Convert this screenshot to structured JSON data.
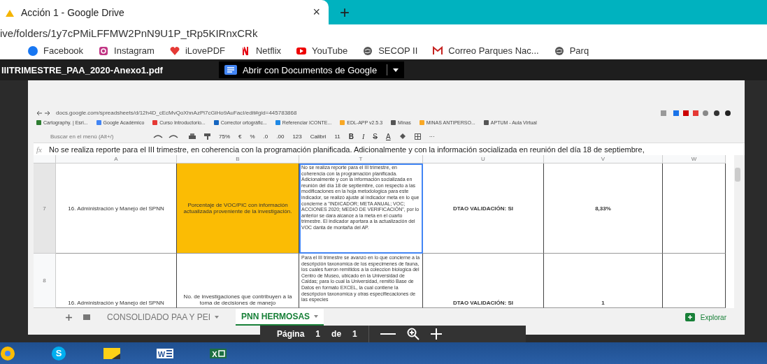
{
  "browser": {
    "tab": {
      "title": "Acción 1 - Google Drive",
      "close": "×",
      "new_tab": "+"
    },
    "url": "ive/folders/1y7cPMiLFFMW2PnN9U1P_tRp5KIRnxCRk",
    "bookmarks": [
      {
        "label": "Facebook",
        "kind": "facebook"
      },
      {
        "label": "Instagram",
        "kind": "instagram"
      },
      {
        "label": "iLovePDF",
        "kind": "heart"
      },
      {
        "label": "Netflix",
        "kind": "netflix"
      },
      {
        "label": "YouTube",
        "kind": "youtube"
      },
      {
        "label": "SECOP II",
        "kind": "globe"
      },
      {
        "label": "Correo Parques Nac...",
        "kind": "mail"
      },
      {
        "label": "Parq",
        "kind": "globe"
      }
    ]
  },
  "pdf_viewer": {
    "filename": "IIITRIMESTRE_PAA_2020-Anexo1.pdf",
    "open_with": "Abrir con Documentos de Google"
  },
  "document": {
    "url": "docs.google.com/spreadsheets/d/12h4D_cEcMvQoXhnAzPi7cGiHo9AuFacI/edit#gid=445783868",
    "bookmarks": [
      {
        "label": "Cartography. | Esri...",
        "color": "#2e7d32"
      },
      {
        "label": "Google Académico",
        "color": "#4285f4"
      },
      {
        "label": "Curso Introductorio...",
        "color": "#e53935"
      },
      {
        "label": "Corrector ortográfic...",
        "color": "#1565c0"
      },
      {
        "label": "Referenciar ICONTE...",
        "color": "#1e88e5"
      },
      {
        "label": "EDL-APP v2.5.3",
        "color": "#f9a825"
      },
      {
        "label": "Minas",
        "color": "#555555"
      },
      {
        "label": "MINAS ANTIPERSO...",
        "color": "#f9a825"
      },
      {
        "label": "APTUM - Aula Virtual",
        "color": "#555555"
      }
    ],
    "toolbar": {
      "search_placeholder": "Buscar en el menú (Alt+/)",
      "zoom": "75%",
      "currency": "€",
      "percent": "%",
      "decimal_less": ".0",
      "decimal_more": ".00",
      "number_format": "123",
      "font": "Calibri",
      "font_size": "11",
      "bold": "B",
      "italic": "I",
      "strike": "S",
      "text_color": "A",
      "more": "···"
    },
    "formula_bar": {
      "label": "fx",
      "value": "No se realiza reporte para el III trimestre, en coherencia con la programación planificada. Adicionalmente y con la información socializada en reunión del día 18 de septiembre,"
    },
    "table": {
      "columns": [
        "A",
        "B",
        "T",
        "U",
        "V",
        "W"
      ],
      "rows": [
        {
          "number": "7",
          "cells": [
            "16. Administración y Manejo del SPNN",
            "Porcentaje de VOC/PIC con información actualizada proveniente de la investigación.",
            "No se realiza reporte para el III trimestre, en coherencia con la programación planificada. Adicionalmente y con la información socializada en reunión del día 18 de septiembre, con respecto a las modificaciones en la hoja metodologica para este indicador, se realizó ajuste al indicador meta en lo que concierne a \"INDICADOR; META ANUAL; VOC; ACCIONES 2020; MEDIO DE VERIFICACIÓN\", por lo anterior se dara alcance a la meta en el cuarto trimestre. El indicador aportara a la actualización del VOC danta de montaña del AP.",
            "DTAO VALIDACIÓN: SI",
            "8,33%"
          ],
          "highlighted": true,
          "selected": true
        },
        {
          "number": "8",
          "cells": [
            "16. Administración y Manejo del SPNN",
            "No. de investigaciones que contribuyen a la toma de decisiones de manejo",
            "Para el III trimestre se avanzó en lo que concierne a la descripción taxonomica de los especimenes de fauna, los cuales fueron remitidos a la coleccion biologica del Centro de Museo, ubicado en la Universidad de Caldas; para lo cual la Universidad,    remitió Base de Datos en formato EXCEL, la cual contiene la descripcion taxonomica y otras especifiecaciones de las especies",
            "DTAO VALIDACIÓN: SI",
            "1"
          ],
          "highlighted": false,
          "selected": false
        }
      ]
    },
    "sheet_tabs": [
      {
        "label": "CONSOLIDADO PAA Y PEI",
        "selected": false
      },
      {
        "label": "PNN HERMOSAS",
        "selected": true
      }
    ],
    "explore": "Explorar"
  },
  "page_control": {
    "label": "Página",
    "page": "1",
    "of": "de",
    "total": "1"
  },
  "taskbar": {
    "apps": [
      {
        "kind": "chrome"
      },
      {
        "kind": "skype",
        "glyph": "S"
      },
      {
        "kind": "notes"
      },
      {
        "kind": "word",
        "glyph": "W"
      },
      {
        "kind": "excel",
        "glyph": "X"
      }
    ]
  }
}
